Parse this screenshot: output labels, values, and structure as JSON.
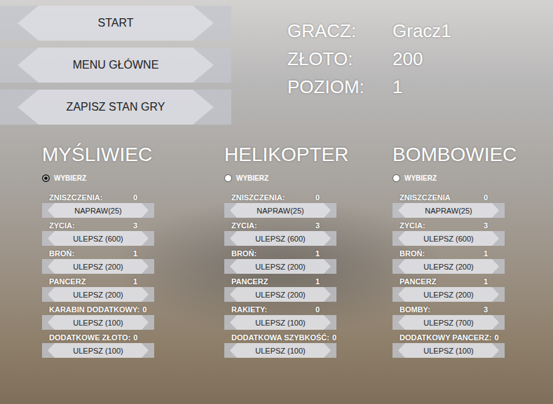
{
  "menu": [
    {
      "label": "START"
    },
    {
      "label": "MENU GŁÓWNE"
    },
    {
      "label": "ZAPISZ STAN GRY"
    }
  ],
  "player": [
    {
      "label": "GRACZ:",
      "value": "Gracz1"
    },
    {
      "label": "ZŁOTO:",
      "value": "200"
    },
    {
      "label": "POZIOM:",
      "value": "1"
    }
  ],
  "aircraft": [
    {
      "name": "MYŚLIWIEC",
      "select_label": "WYBIERZ",
      "selected": true,
      "stats": [
        {
          "label": "ZNISZCZENIA:",
          "value": "0",
          "button": "NAPRAW(25)"
        },
        {
          "label": "ZYCIA:",
          "value": "3",
          "button": "ULEPSZ (600)"
        },
        {
          "label": "BROŃ:",
          "value": "1",
          "button": "ULEPSZ (200)"
        },
        {
          "label": "PANCERZ",
          "value": "1",
          "button": "ULEPSZ (200)"
        },
        {
          "label": "KARABIN DODATKOWY:",
          "value": "0",
          "button": "ULEPSZ (100)"
        },
        {
          "label": "DODATKOWE ZŁOTO:",
          "value": "0",
          "button": "ULEPSZ (100)"
        }
      ]
    },
    {
      "name": "HELIKOPTER",
      "select_label": "WYBIERZ",
      "selected": false,
      "stats": [
        {
          "label": "ZNISZCZENIA:",
          "value": "0",
          "button": "NAPRAW(25)"
        },
        {
          "label": "ZYCIA:",
          "value": "3",
          "button": "ULEPSZ (600)"
        },
        {
          "label": "BROŃ:",
          "value": "1",
          "button": "ULEPSZ (200)"
        },
        {
          "label": "PANCERZ",
          "value": "1",
          "button": "ULEPSZ (200)"
        },
        {
          "label": "RAKIETY:",
          "value": "0",
          "button": "ULEPSZ (100)"
        },
        {
          "label": "DODATKOWA SZYBKOŚĆ:",
          "value": "0",
          "button": "ULEPSZ (100)"
        }
      ]
    },
    {
      "name": "BOMBOWIEC",
      "select_label": "WYBIERZ",
      "selected": false,
      "stats": [
        {
          "label": "ZNISZCZENIA",
          "value": "0",
          "button": "NAPRAW(25)"
        },
        {
          "label": "ZYCIA:",
          "value": "3",
          "button": "ULEPSZ (600)"
        },
        {
          "label": "BROŃ:",
          "value": "1",
          "button": "ULEPSZ (200)"
        },
        {
          "label": "PANCERZ",
          "value": "1",
          "button": "ULEPSZ (200)"
        },
        {
          "label": "BOMBY:",
          "value": "3",
          "button": "ULEPSZ (700)"
        },
        {
          "label": "DODATKOWY PANCERZ:",
          "value": "0",
          "button": "ULEPSZ (100)"
        }
      ]
    }
  ]
}
